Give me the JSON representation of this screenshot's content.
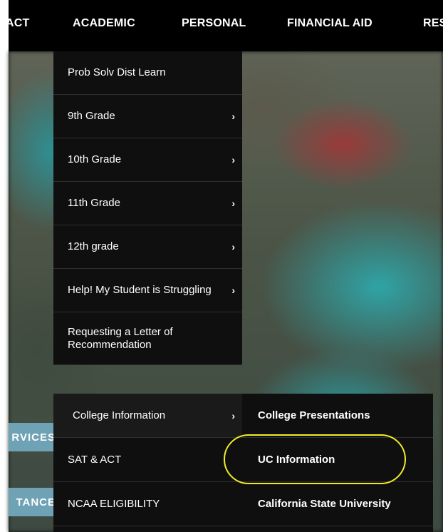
{
  "topnav": {
    "items": [
      "ACT",
      "ACADEMIC",
      "PERSONAL",
      "FINANCIAL AID",
      "RES"
    ]
  },
  "side_buttons": [
    "RVICES",
    "TANCE"
  ],
  "menu": {
    "items": [
      {
        "label": "Prob Solv Dist Learn",
        "chevron": false
      },
      {
        "label": "9th Grade",
        "chevron": true
      },
      {
        "label": "10th Grade",
        "chevron": true
      },
      {
        "label": "11th Grade",
        "chevron": true
      },
      {
        "label": "12th grade",
        "chevron": true
      },
      {
        "label": "Help! My Student is Struggling",
        "chevron": true
      },
      {
        "label": "Requesting a Letter of Recommendation",
        "chevron": false
      }
    ],
    "lower": [
      {
        "label": "College Information",
        "chevron": "›",
        "submenu": "College Presentations"
      },
      {
        "label": "SAT & ACT",
        "submenu": "UC Information"
      },
      {
        "label": "NCAA ELIGIBILITY",
        "submenu": "California State University"
      }
    ]
  },
  "chevron_glyph": "›",
  "colors": {
    "highlight": "#f2ec27",
    "side_button": "#6ea2b4"
  }
}
